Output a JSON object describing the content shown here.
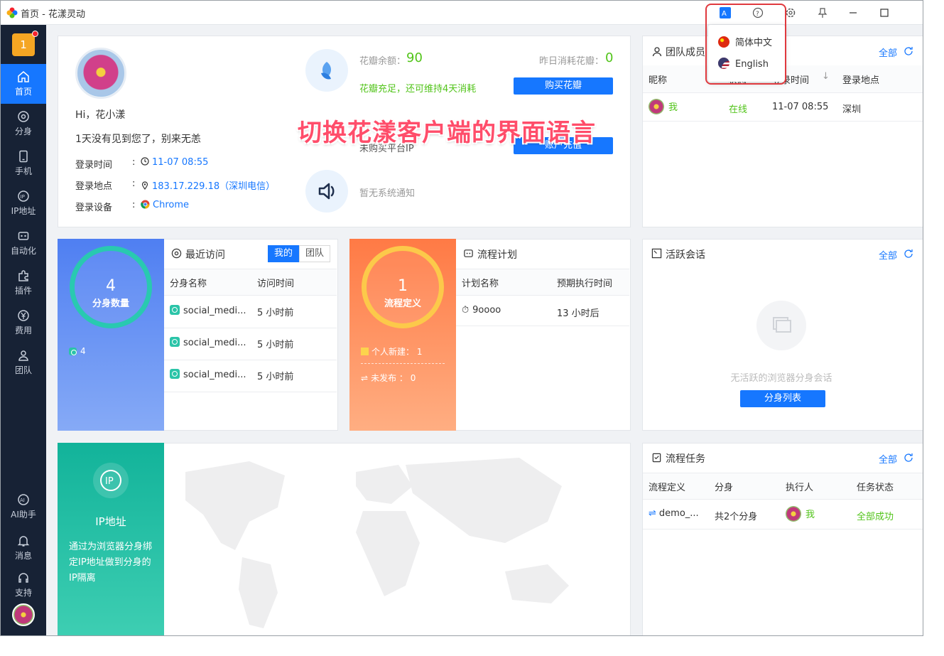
{
  "window": {
    "title": "首页 - 花漾灵动"
  },
  "titlebar": {
    "icons": [
      "translate-icon",
      "help-icon",
      "settings-icon",
      "pin-icon",
      "minimize-icon",
      "maximize-icon"
    ]
  },
  "language_menu": {
    "items": [
      "简体中文",
      "English"
    ]
  },
  "overlay_caption": "切换花漾客户端的界面语言",
  "sidebar": {
    "badge": "1",
    "items": [
      {
        "label": "首页",
        "icon": "home-icon"
      },
      {
        "label": "分身",
        "icon": "browser-icon"
      },
      {
        "label": "手机",
        "icon": "phone-icon"
      },
      {
        "label": "IP地址",
        "icon": "ip-icon"
      },
      {
        "label": "自动化",
        "icon": "robot-icon"
      },
      {
        "label": "插件",
        "icon": "puzzle-icon"
      },
      {
        "label": "费用",
        "icon": "yen-icon"
      },
      {
        "label": "团队",
        "icon": "team-icon"
      }
    ],
    "bottom_items": [
      {
        "label": "AI助手",
        "icon": "ai-icon"
      },
      {
        "label": "消息",
        "icon": "bell-icon"
      },
      {
        "label": "支持",
        "icon": "headset-icon"
      }
    ]
  },
  "profile": {
    "greeting": "Hi，花小漾",
    "welcome": "1天没有见到您了，别来无恙",
    "login_time_label": "登录时间",
    "login_time": "11-07 08:55",
    "login_location_label": "登录地点",
    "login_location": "183.17.229.18（深圳电信）",
    "login_device_label": "登录设备",
    "login_device": "Chrome",
    "colon": ":"
  },
  "balance": {
    "label": "花瓣余额：",
    "value": "90",
    "yesterday_label": "昨日消耗花瓣：",
    "yesterday_value": "0",
    "status": "花瓣充足，还可维持4天消耗",
    "buy_button": "购买花瓣",
    "ip_text": "未购买平台IP",
    "recharge_button": "账户充值",
    "notice": "暂无系统通知"
  },
  "team_members": {
    "title": "团队成员",
    "all_link": "全部",
    "columns": [
      "昵称",
      "状态",
      "登录时间",
      "登录地点"
    ],
    "rows": [
      {
        "name": "我",
        "status": "在线",
        "time": "11-07 08:55",
        "location": "深圳"
      }
    ]
  },
  "profiles_card": {
    "count": "4",
    "count_label": "分身数量",
    "small_count": "4",
    "recent_title": "最近访问",
    "tab_mine": "我的",
    "tab_team": "团队",
    "columns": [
      "分身名称",
      "访问时间"
    ],
    "rows": [
      {
        "name": "social_medi...",
        "time": "5 小时前"
      },
      {
        "name": "social_medi...",
        "time": "5 小时前"
      },
      {
        "name": "social_medi...",
        "time": "5 小时前"
      }
    ]
  },
  "flow_card": {
    "count": "1",
    "count_label": "流程定义",
    "personal_label": "个人新建：",
    "personal_value": "1",
    "unpublished_label": "未发布",
    "unpublished_value": "：  0",
    "plan_title": "流程计划",
    "columns": [
      "计划名称",
      "预期执行时间"
    ],
    "rows": [
      {
        "name": "9oooo",
        "time": "13 小时后"
      }
    ]
  },
  "sessions": {
    "title": "活跃会话",
    "all_link": "全部",
    "empty_text": "无活跃的浏览器分身会话",
    "button": "分身列表"
  },
  "ip_card": {
    "title": "IP地址",
    "desc": "通过为浏览器分身绑定IP地址做到分身的IP隔离"
  },
  "tasks": {
    "title": "流程任务",
    "all_link": "全部",
    "columns": [
      "流程定义",
      "分身",
      "执行人",
      "任务状态"
    ],
    "rows": [
      {
        "flow": "demo_...",
        "profiles": "共2个分身",
        "executor": "我",
        "status": "全部成功"
      }
    ]
  },
  "colors": {
    "primary": "#1677ff",
    "sidebar": "#172235",
    "success": "#52c41a",
    "orange": "#ff8a4c",
    "teal": "#1fbfa5"
  }
}
